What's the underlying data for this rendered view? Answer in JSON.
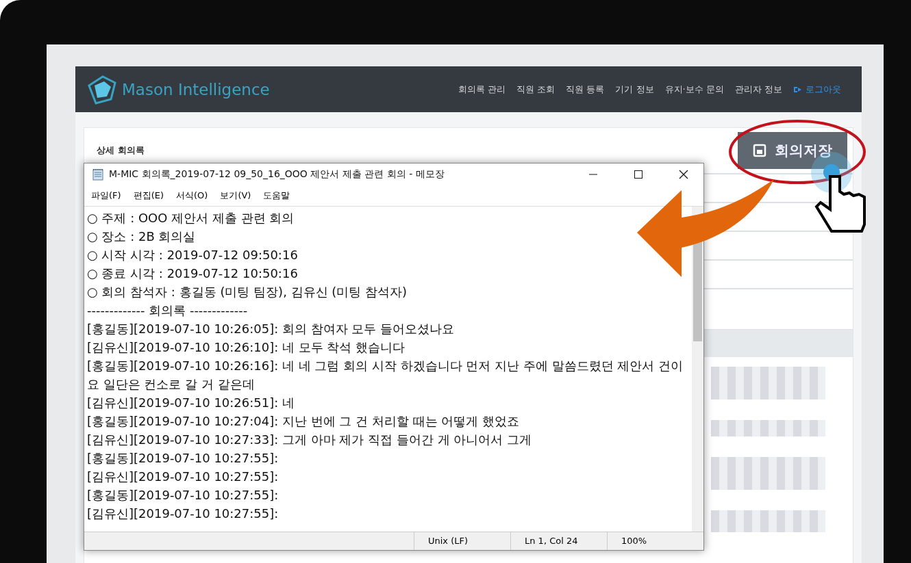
{
  "navbar": {
    "brand": "Mason Intelligence",
    "items": [
      "회의록 관리",
      "직원 조회",
      "직원 등록",
      "기기 정보",
      "유지·보수 문의",
      "관리자 정보"
    ],
    "logout": "로그아웃"
  },
  "page": {
    "title": "상세 회의록",
    "save_button": "회의저장"
  },
  "notepad": {
    "title": "M-MIC 회의록_2019-07-12 09_50_16_OOO 제안서 제출 관련 회의 - 메모장",
    "menu": [
      "파일(F)",
      "편집(E)",
      "서식(O)",
      "보기(V)",
      "도움말"
    ],
    "lines": [
      "○ 주제 : OOO 제안서 제출 관련 회의",
      "○ 장소 : 2B 회의실",
      "○ 시작 시각 : 2019-07-12 09:50:16",
      "○ 종료 시각 : 2019-07-12 10:50:16",
      "○ 회의 참석자 : 홍길동 (미팅 팀장), 김유신 (미팅 참석자)",
      "------------- 회의록 -------------",
      "[홍길동][2019-07-10 10:26:05]: 회의 참여자 모두 들어오셨나요",
      "[김유신][2019-07-10 10:26:10]: 네 모두 착석 했습니다",
      "[홍길동][2019-07-10 10:26:16]: 네 네 그럼 회의 시작 하겠습니다 먼저 지난 주에 말씀드렸던 제안서 건이요 일단은 컨소로 갈 거 같은데",
      "[김유신][2019-07-10 10:26:51]: 네",
      "[홍길동][2019-07-10 10:27:04]: 지난 번에 그 건 처리할 때는 어떻게 했었죠",
      "[김유신][2019-07-10 10:27:33]: 그게 아마 제가 직접 들어간 게 아니어서 그게",
      "[홍길동][2019-07-10 10:27:55]:",
      "[김유신][2019-07-10 10:27:55]:",
      "[홍길동][2019-07-10 10:27:55]:",
      "[김유신][2019-07-10 10:27:55]:"
    ],
    "status": [
      "Unix (LF)",
      "Ln 1, Col 24",
      "100%"
    ]
  }
}
